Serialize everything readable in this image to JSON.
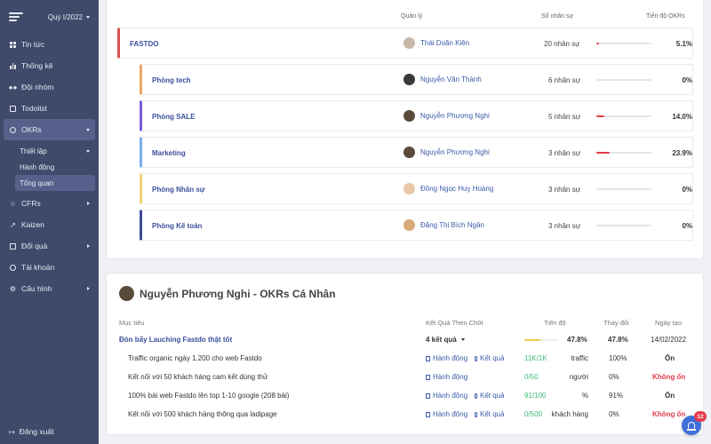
{
  "sidebar": {
    "quarter": "Quý I/2022",
    "items": [
      {
        "label": "Tin tức"
      },
      {
        "label": "Thống kê"
      },
      {
        "label": "Đội nhóm"
      },
      {
        "label": "Todolist"
      },
      {
        "label": "OKRs"
      },
      {
        "label": "CFRs"
      },
      {
        "label": "Kaizen"
      },
      {
        "label": "Đổi quà"
      },
      {
        "label": "Tài khoản"
      },
      {
        "label": "Cấu hình"
      }
    ],
    "okr_sub": [
      {
        "label": "Thiết lập"
      },
      {
        "label": "Hành động"
      },
      {
        "label": "Tổng quan"
      }
    ],
    "logout": "Đăng xuất"
  },
  "teams": {
    "headers": {
      "manager": "Quản lý",
      "members": "Số nhân sự",
      "progress": "Tiến độ OKRs"
    },
    "rows": [
      {
        "name": "FASTDO",
        "manager": "Thái Doãn Kiên",
        "members": "20 nhân sự",
        "progress": "5.1%",
        "progress_value": 5.1,
        "color": "#d9534f"
      },
      {
        "name": "Phòng tech",
        "manager": "Nguyễn Văn Thành",
        "members": "6 nhân sự",
        "progress": "0%",
        "progress_value": 0,
        "color": "#f0a868"
      },
      {
        "name": "Phòng SALE",
        "manager": "Nguyễn Phương Nghi",
        "members": "5 nhân sự",
        "progress": "14.0%",
        "progress_value": 14.0,
        "color": "#7b5cd6"
      },
      {
        "name": "Marketing",
        "manager": "Nguyễn Phương Nghi",
        "members": "3 nhân sự",
        "progress": "23.9%",
        "progress_value": 23.9,
        "color": "#7aaee8"
      },
      {
        "name": "Phòng Nhân sự",
        "manager": "Đồng Ngọc Huy Hoàng",
        "members": "3 nhân sự",
        "progress": "0%",
        "progress_value": 0,
        "color": "#f2d27a"
      },
      {
        "name": "Phòng Kế toán",
        "manager": "Đặng Thị Bích Ngân",
        "members": "3 nhân sự",
        "progress": "0%",
        "progress_value": 0,
        "color": "#3f4a9a"
      }
    ]
  },
  "personal": {
    "title": "Nguyễn Phương Nghi - OKRs Cá Nhân",
    "headers": {
      "objective": "Mục tiêu",
      "key_results": "Kết Quả Then Chốt",
      "progress": "Tiến độ",
      "change": "Thay đổi",
      "created": "Ngày tạo"
    },
    "objective": {
      "label": "Đòn bẩy Lauching Fastdo thật tốt",
      "kr_summary": "4 kết quả",
      "progress": "47.8%",
      "progress_value": 47.8,
      "change": "47.8%",
      "created": "14/02/2022"
    },
    "action_label": "Hành động",
    "result_label": "Kết quả",
    "key_results": [
      {
        "text": "Traffic organic ngày 1.200 cho web Fastdo",
        "ratio": "11K/1K",
        "unit": "traffic",
        "change": "100%",
        "status": "Ổn",
        "status_type": "good",
        "has_result": true
      },
      {
        "text": "Kết nối với 50 khách hàng cam kết dùng thử",
        "ratio": "0/50",
        "unit": "người",
        "change": "0%",
        "status": "Không ổn",
        "status_type": "bad",
        "has_result": false
      },
      {
        "text": "100% bài web Fastdo lên top 1-10 google (208 bài)",
        "ratio": "91/100",
        "unit": "%",
        "change": "91%",
        "status": "Ổn",
        "status_type": "good",
        "has_result": true
      },
      {
        "text": "Kết nối với 500 khách hàng thông qua ladipage",
        "ratio": "0/500",
        "unit": "khách hàng",
        "change": "0%",
        "status": "Không ổn",
        "status_type": "bad",
        "has_result": true
      }
    ]
  },
  "notifications": {
    "count": "12"
  }
}
